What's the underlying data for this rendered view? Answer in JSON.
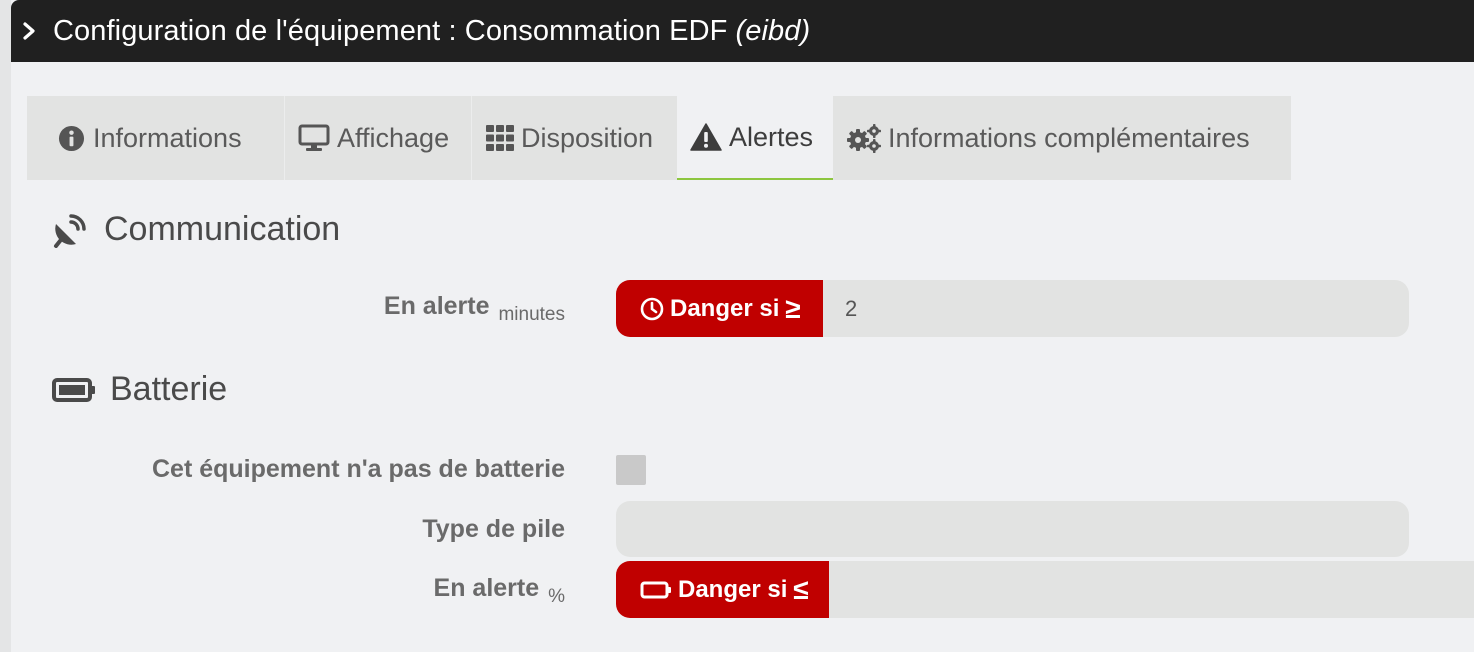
{
  "header": {
    "title": "Configuration de l'équipement : Consommation EDF",
    "plugin": "(eibd)"
  },
  "tabs": [
    {
      "label": "Informations",
      "icon": "info-circle-icon",
      "active": false
    },
    {
      "label": "Affichage",
      "icon": "desktop-icon",
      "active": false
    },
    {
      "label": "Disposition",
      "icon": "grid-icon",
      "active": false
    },
    {
      "label": "Alertes",
      "icon": "warning-icon",
      "active": true
    },
    {
      "label": "Informations complémentaires",
      "icon": "gears-icon",
      "active": false
    }
  ],
  "communication": {
    "title": "Communication",
    "icon": "satellite-dish-icon",
    "alert_label": "En alerte",
    "alert_unit": "minutes",
    "danger_label": "Danger si",
    "danger_symbol": "≥",
    "danger_icon": "clock-icon",
    "value": "2"
  },
  "battery": {
    "title": "Batterie",
    "icon": "battery-icon",
    "no_battery_label": "Cet équipement n'a pas de batterie",
    "no_battery_checked": false,
    "type_label": "Type de pile",
    "type_value": "",
    "alert_label": "En alerte",
    "alert_unit": "%",
    "danger_label": "Danger si",
    "danger_symbol": "≤",
    "danger_icon": "battery-empty-icon",
    "value": ""
  },
  "colors": {
    "header_bg": "#202020",
    "danger": "#c00000",
    "active_tab_underline": "#8dc63f",
    "page_bg": "#f0f1f3"
  }
}
